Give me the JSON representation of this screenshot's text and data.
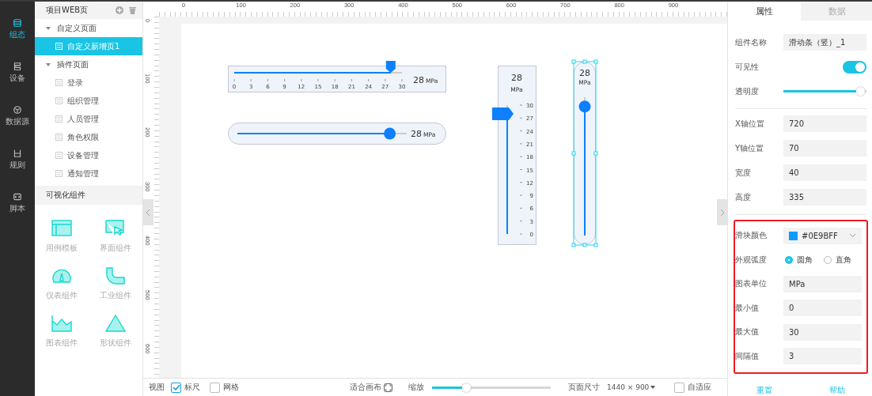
{
  "nav": [
    {
      "label": "组态",
      "selected": true
    },
    {
      "label": "设备",
      "selected": false
    },
    {
      "label": "数据源",
      "selected": false
    },
    {
      "label": "规则",
      "selected": false
    },
    {
      "label": "脚本",
      "selected": false
    }
  ],
  "sidebar": {
    "title": "项目WEB页",
    "tree": [
      {
        "label": "自定义页面",
        "expanded": true,
        "children": [
          {
            "label": "自定义新增页1",
            "selected": true
          }
        ]
      },
      {
        "label": "插件页面",
        "expanded": true,
        "children": [
          {
            "label": "登录",
            "selected": false
          },
          {
            "label": "组织管理",
            "selected": false
          },
          {
            "label": "人员管理",
            "selected": false
          },
          {
            "label": "角色权限",
            "selected": false
          },
          {
            "label": "设备管理",
            "selected": false
          },
          {
            "label": "通知管理",
            "selected": false
          }
        ]
      }
    ],
    "components_title": "可视化组件",
    "components": [
      {
        "label": "用例模板"
      },
      {
        "label": "界面组件"
      },
      {
        "label": "仪表组件"
      },
      {
        "label": "工业组件"
      },
      {
        "label": "图表组件"
      },
      {
        "label": "形状组件"
      }
    ]
  },
  "ruler": {
    "horizontal": [
      "0",
      "100",
      "200",
      "300",
      "400",
      "500",
      "600",
      "700",
      "800",
      "900"
    ],
    "vertical": [
      "0",
      "100",
      "200",
      "300",
      "400",
      "500",
      "600"
    ]
  },
  "widgets": [
    {
      "kind": "ticked-horizontal",
      "value": "28",
      "unit": "MPa",
      "level": 0.933,
      "ticks": [
        "0",
        "3",
        "6",
        "9",
        "12",
        "15",
        "18",
        "21",
        "24",
        "27",
        "30"
      ]
    },
    {
      "kind": "round-horizontal",
      "value": "28",
      "unit": "MPa",
      "level": 0.9
    },
    {
      "kind": "ticked-vertical",
      "value": "28",
      "unit": "MPa",
      "level": 0.933,
      "ticks": [
        "30",
        "27",
        "24",
        "21",
        "18",
        "15",
        "12",
        "9",
        "6",
        "3",
        "0"
      ]
    },
    {
      "kind": "round-vertical",
      "value": "28",
      "unit": "MPa",
      "level": 0.933,
      "selected": true
    }
  ],
  "bottom_bar": {
    "view_label": "视图",
    "checks": [
      {
        "label": "标尺",
        "checked": true
      },
      {
        "label": "网格",
        "checked": false
      }
    ],
    "fit_label": "适合画布",
    "zoom_label": "缩放",
    "zoom": {
      "level": 0.27
    },
    "page_size_label": "页面尺寸",
    "page_size": "1440 × 900",
    "adaptive": {
      "label": "自适应",
      "checked": false
    }
  },
  "panel": {
    "tabs": [
      {
        "label": "属性",
        "selected": true
      },
      {
        "label": "数据",
        "selected": false
      }
    ],
    "groups": [
      {
        "rows": [
          {
            "kind": "field",
            "label": "组件名称",
            "value": "滑动条（竖）_1"
          },
          {
            "kind": "toggle",
            "label": "可见性",
            "on": true
          },
          {
            "kind": "slider",
            "label": "透明度",
            "level": 0.98
          }
        ]
      },
      {
        "rows": [
          {
            "kind": "field",
            "label": "X轴位置",
            "value": "720"
          },
          {
            "kind": "field",
            "label": "Y轴位置",
            "value": "70"
          },
          {
            "kind": "field",
            "label": "宽度",
            "value": "40"
          },
          {
            "kind": "field",
            "label": "高度",
            "value": "335"
          }
        ]
      },
      {
        "highlighted": true,
        "rows": [
          {
            "kind": "color",
            "label": "滑块颜色",
            "value": "#0E9BFF",
            "color": "#0e9bff"
          },
          {
            "kind": "radio",
            "label": "外观弧度",
            "options": [
              {
                "label": "圆角",
                "selected": true
              },
              {
                "label": "直角",
                "selected": false
              }
            ]
          },
          {
            "kind": "field",
            "label": "图表单位",
            "value": "MPa"
          },
          {
            "kind": "field",
            "label": "最小值",
            "value": "0"
          },
          {
            "kind": "field",
            "label": "最大值",
            "value": "30"
          },
          {
            "kind": "field",
            "label": "间隔值",
            "value": "3"
          }
        ]
      }
    ],
    "buttons": [
      "重置",
      "帮助"
    ]
  }
}
